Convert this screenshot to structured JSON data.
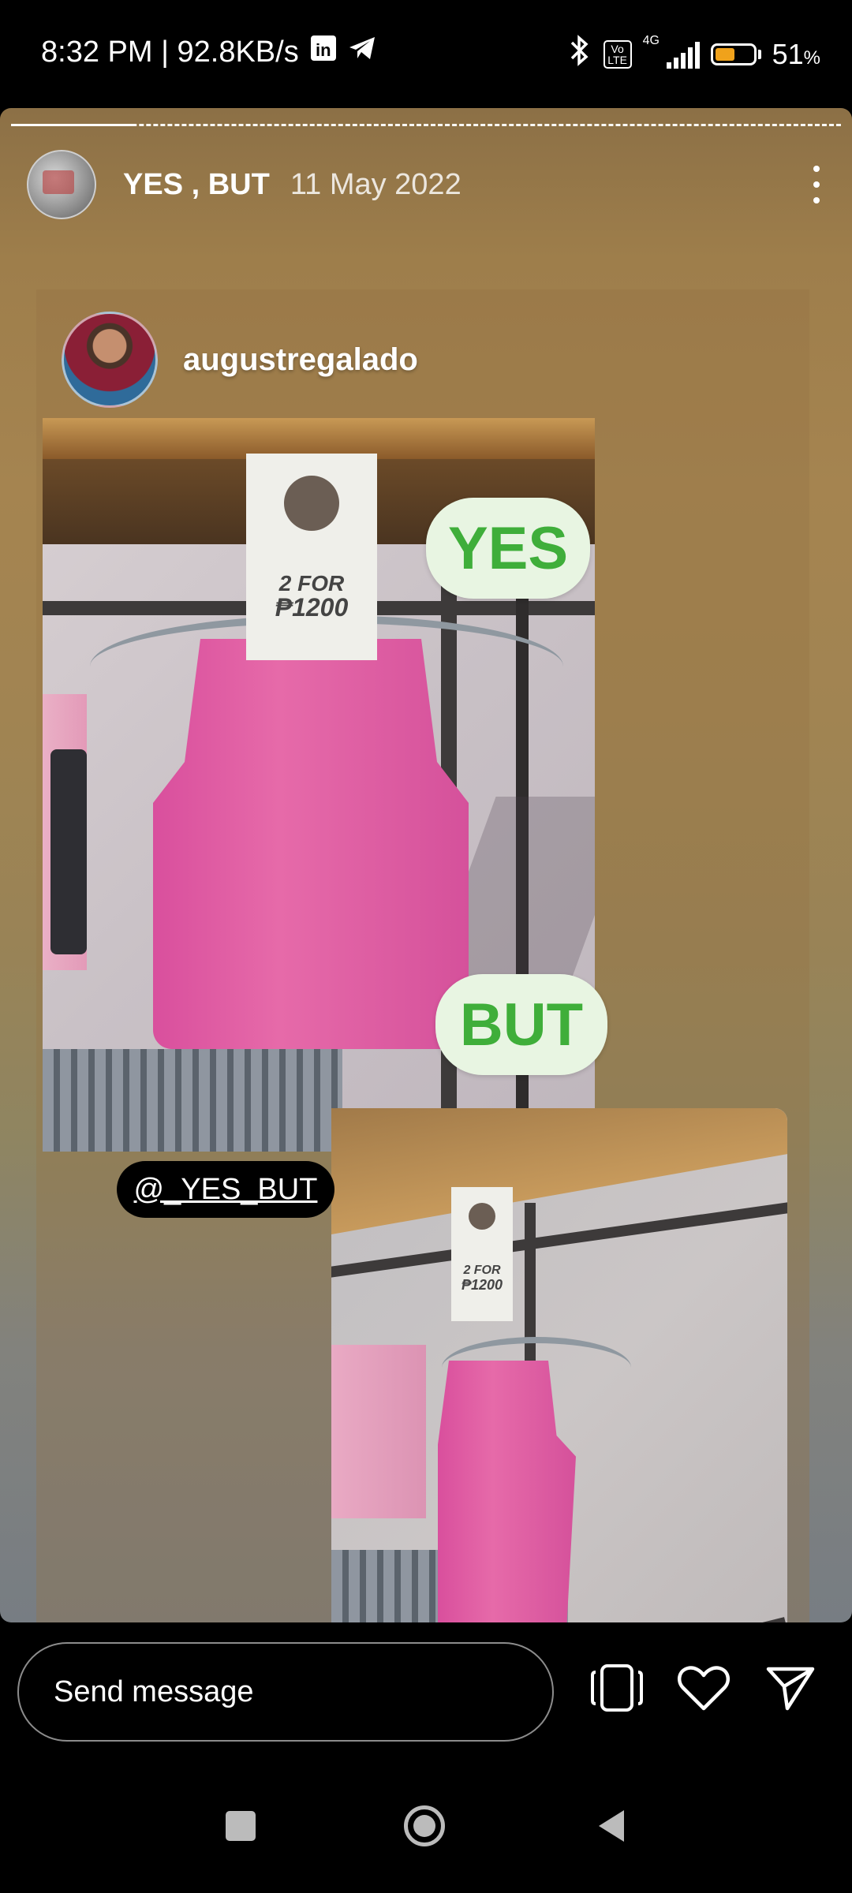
{
  "status_bar": {
    "time_speed": "8:32 PM | 92.8KB/s",
    "linkedin_icon": "linkedin-icon",
    "telegram_icon": "telegram-icon",
    "volte": "Vo LTE",
    "network": "4G",
    "battery_percent": "51",
    "battery_unit": "%"
  },
  "story": {
    "account": "YES , BUT",
    "date": "11 May 2022",
    "progress_fraction": 0.15
  },
  "post": {
    "username": "augustregalado",
    "label_yes": "YES",
    "label_but": "BUT",
    "tag1_line1": "2 FOR",
    "tag1_line2": "₱1200",
    "tag2_line1": "2 FOR",
    "tag2_line2": "₱1200",
    "mention": "@_YES_BUT"
  },
  "message_bar": {
    "placeholder": "Send message"
  },
  "colors": {
    "bubble_bg": "#e8f5e2",
    "bubble_text": "#3fae3a",
    "top_pink": "#d94f9d"
  }
}
